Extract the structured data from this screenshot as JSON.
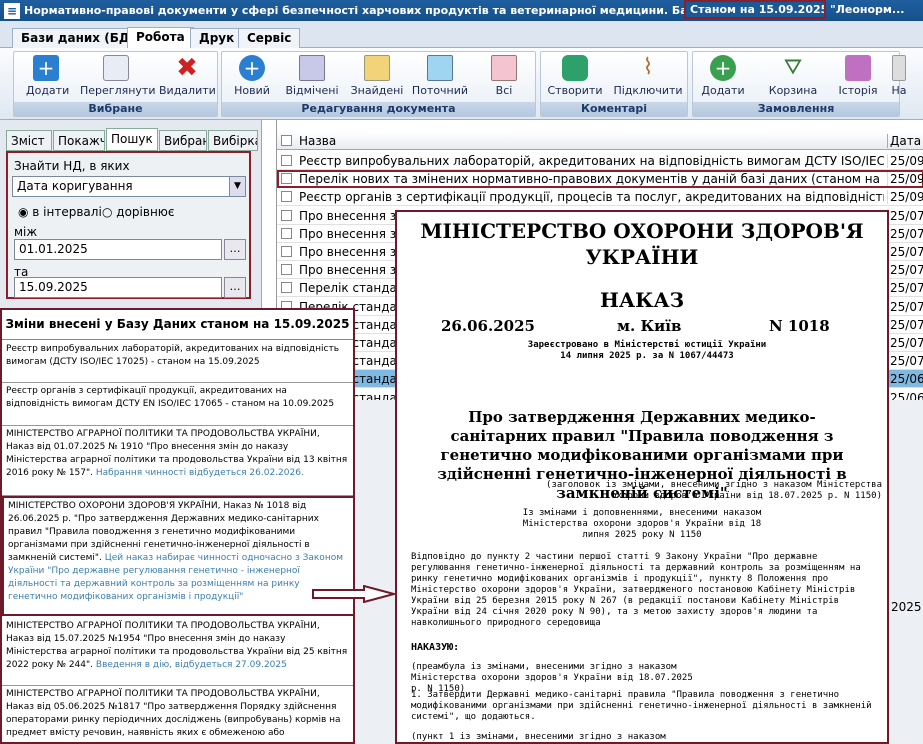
{
  "window": {
    "title": "Нормативно-правові документи у сфері безпечності харчових продуктів та ветеринарної медицини. База даних",
    "status": "Станом на 15.09.2025 р. -",
    "title_rest": "\"Леонорм..."
  },
  "ribbon_tabs": [
    "Бази даних (БД)",
    "Робота",
    "Друк",
    "Сервіс"
  ],
  "groups": {
    "vybrane": {
      "label": "Вибране",
      "buttons": [
        "Додати",
        "Переглянути",
        "Видалити"
      ]
    },
    "redag": {
      "label": "Редагування документа",
      "buttons": [
        "Новий",
        "Відмічені",
        "Знайдені",
        "Поточний",
        "Всі"
      ]
    },
    "koment": {
      "label": "Коментарі",
      "buttons": [
        "Створити",
        "Підключити"
      ]
    },
    "zamov": {
      "label": "Замовлення",
      "buttons": [
        "Додати",
        "Корзина",
        "Історія",
        "На"
      ]
    }
  },
  "left_tabs": [
    "Зміст",
    "Покажч",
    "Пошук",
    "Вибрані",
    "Вибірка"
  ],
  "search": {
    "find_label": "Знайти НД, в яких",
    "field_value": "Дата коригування",
    "radio_interval": "в інтервалі",
    "radio_equal": "дорівнює",
    "between_label": "між",
    "from": "01.01.2025",
    "to_label": "та",
    "to": "15.09.2025"
  },
  "grid": {
    "col_name": "Назва",
    "col_date": "Дата кор",
    "rows": [
      {
        "name": "Реєстр випробувальних лабораторій, акредитованих на відповідність вимогам ДСТУ ISO/IEC 17025",
        "date": "25/09/"
      },
      {
        "name": "Перелік нових та змінених нормативно-правових документів у даній базі даних (станом на 15.09.2025 )",
        "date": "25/09/"
      },
      {
        "name": "Реєстр органів з сертифікації продукції, процесів та послуг, акредитованих на відповідність вимогам ДСТ",
        "date": "25/09/"
      },
      {
        "name": "Про внесення змін до наказу Міністерства аграрної політики та продовольства України від 25 квітня 20",
        "date": "25/07/"
      },
      {
        "name": "Про внесення змі",
        "date": "25/07/"
      },
      {
        "name": "Про внесення змі",
        "date": "25/07/"
      },
      {
        "name": "Про внесення змі",
        "date": "25/07/"
      },
      {
        "name": "Перелік стандарт",
        "date": "25/07/"
      },
      {
        "name": "Перелік стандарт",
        "date": "25/07/"
      },
      {
        "name": "Перелік стандарт",
        "date": "25/07/"
      },
      {
        "name": "Перелік стандарт",
        "date": "25/07/"
      },
      {
        "name": "Перелік стандарт",
        "date": "25/07/"
      },
      {
        "name": "Перелік стандарт",
        "date": "25/06/"
      },
      {
        "name": "Перелік стандарт",
        "date": "25/06/"
      },
      {
        "name": "Перелік стандарт",
        "date": "25/06/"
      }
    ]
  },
  "changes": {
    "title": "Зміни внесені у Базу Даних станом на 15.09.2025",
    "entries": [
      {
        "text": "Реєстр випробувальних лабораторій, акредитованих на відповідність вимогам (ДСТУ ISO/IEC 17025) - станом на 15.09.2025",
        "link": ""
      },
      {
        "text": "Реєстр органів з сертифікації продукції, акредитованих на відповідність вимогам ДСТУ EN ISO/IEC 17065 - станом на 10.09.2025",
        "link": ""
      },
      {
        "text": "МІНІСТЕРСТВО АГРАРНОЇ ПОЛІТИКИ ТА ПРОДОВОЛЬСТВА УКРАЇНИ, Наказ від 01.07.2025 № 1910 \"Про внесення змін до наказу Міністерства аграрної політики та продовольства України від 13 квітня 2016 року № 157\".",
        "link": "Набрання чинності відбудеться 26.02.2026."
      },
      {
        "text": "МІНІСТЕРСТВО ОХОРОНИ ЗДОРОВ'Я УКРАЇНИ, Наказ № 1018 від 26.06.2025 р. \"Про затвердження Державних медико-санітарних правил \"Правила поводження з генетично модифікованими організмами при здійсненні генетично-інженерної діяльності в замкненій системі\".",
        "link": "Цей наказ набирає чинності одночасно з Законом України \"Про державне регулювання генетично - інженерної діяльності та державний контроль за розміщенням на ринку генетично модифікованих організмів і продукції\""
      },
      {
        "text": "МІНІСТЕРСТВО АГРАРНОЇ ПОЛІТИКИ ТА ПРОДОВОЛЬСТВА УКРАЇНИ, Наказ від 15.07.2025 №1954 \"Про внесення змін до наказу Міністерства аграрної політики та продовольства України від 25 квітня 2022 року № 244\".",
        "link": "Введення в дію, відбудеться 27.09.2025"
      },
      {
        "text": "МІНІСТЕРСТВО АГРАРНОЇ ПОЛІТИКИ ТА ПРОДОВОЛЬСТВА УКРАЇНИ, Наказ від 05.06.2025 №1817 \"Про затвердження Порядку здійснення операторами ринку періодичних досліджень (випробувань) кормів на предмет вмісту речовин, наявність яких є обмеженою або",
        "link": ""
      }
    ]
  },
  "doc": {
    "ministry": "МІНІСТЕРСТВО ОХОРОНИ ЗДОРОВ'Я УКРАЇНИ",
    "type": "НАКАЗ",
    "date": "26.06.2025",
    "city": "м. Київ",
    "number": "N 1018",
    "registered": "Зареєстровано в Міністерстві юстиції України",
    "registered2": "14 липня 2025 р. за N 1067/44473",
    "title": "Про затвердження Державних медико-санітарних правил \"Правила поводження з генетично модифікованими організмами при здійсненні генетично-інженерної діяльності в замкненій системі\"",
    "note1": "(заголовок із змінами, внесеними згідно з наказом Міністерства охорони здоров'я України від 18.07.2025 р. N 1150)",
    "note2": "Із змінами і доповненнями, внесеними наказом Міністерства охорони здоров'я України від 18 липня 2025 року N 1150",
    "body1": "Відповідно до пункту 2 частини першої статті 9 Закону України \"Про державне регулювання генетично-інженерної діяльності та державний контроль за розміщенням на ринку генетично модифікованих організмів і продукції\", пункту 8 Положення про Міністерство охорони здоров'я України, затвердженого постановою Кабінету Міністрів України від 25 березня 2015 року N 267 (в редакції постанови Кабінету Міністрів України від 24 січня 2020 року N 90), та з метою захисту здоров'я людини та навколишнього природного середовища",
    "nakazuyu": "НАКАЗУЮ:",
    "body2": "(преамбула із змінами, внесеними згідно з наказом Міністерства охорони здоров'я України від 18.07.2025 р. N 1150)",
    "body3": "1. Затвердити Державні медико-санітарні правила \"Правила поводження з генетично модифікованими організмами при здійсненні генетично-інженерної діяльності в замкненій системі\", що додаються.",
    "body4": "(пункт 1 із змінами, внесеними згідно з наказом"
  },
  "behind_text": [
    "тів ISO/IEC 17",
    "тів",
    "тів ISO/IEC",
    "тів",
    "тів ДСТУ",
    "ладанн",
    "ї змі",
    "тиці"
  ]
}
